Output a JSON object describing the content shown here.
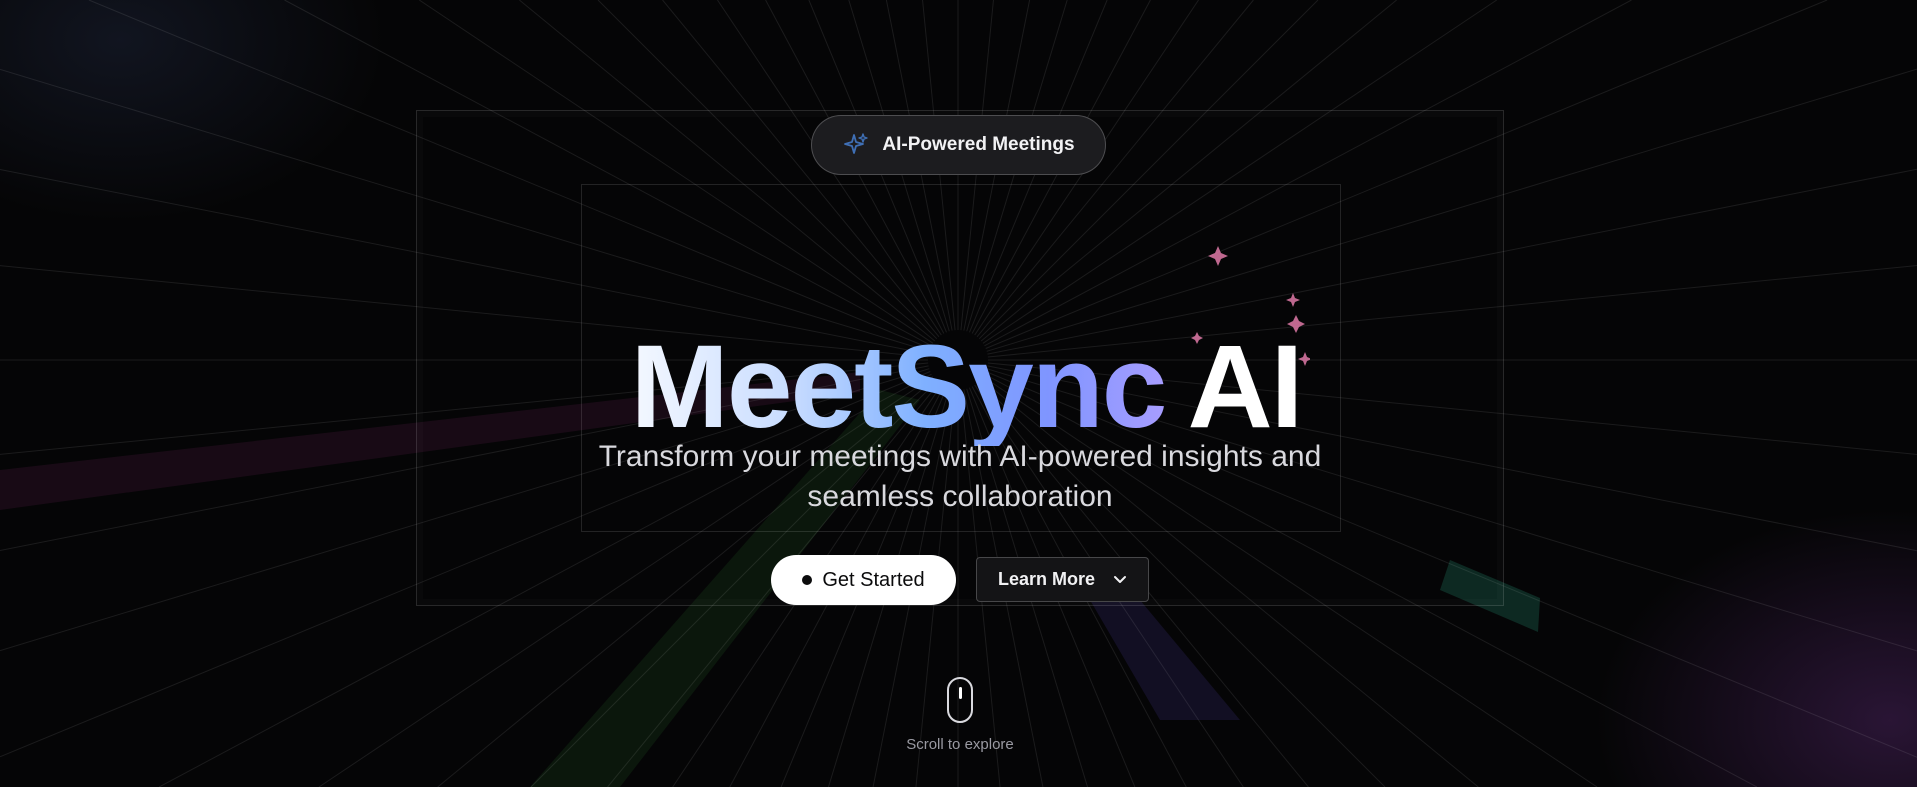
{
  "badge": {
    "label": "AI-Powered Meetings",
    "icon": "sparkle-icon",
    "icon_color": "#3f6fb5"
  },
  "hero": {
    "title_main": "MeetSync",
    "title_accent": "AI",
    "subtitle": "Transform your meetings with AI-powered insights and seamless collaboration",
    "title_gradient": [
      "#f4f8ff",
      "#c8dcff",
      "#7fb0ff",
      "#7f95ff",
      "#a79dff"
    ],
    "sparkle_color": "#e07aa8"
  },
  "actions": {
    "primary_label": "Get Started",
    "secondary_label": "Learn More",
    "secondary_icon": "chevron-down-icon"
  },
  "scroll": {
    "label": "Scroll to explore",
    "icon": "mouse-icon"
  },
  "colors": {
    "background": "#050506",
    "primary_button": "#ffffff",
    "secondary_button": "#141416"
  }
}
